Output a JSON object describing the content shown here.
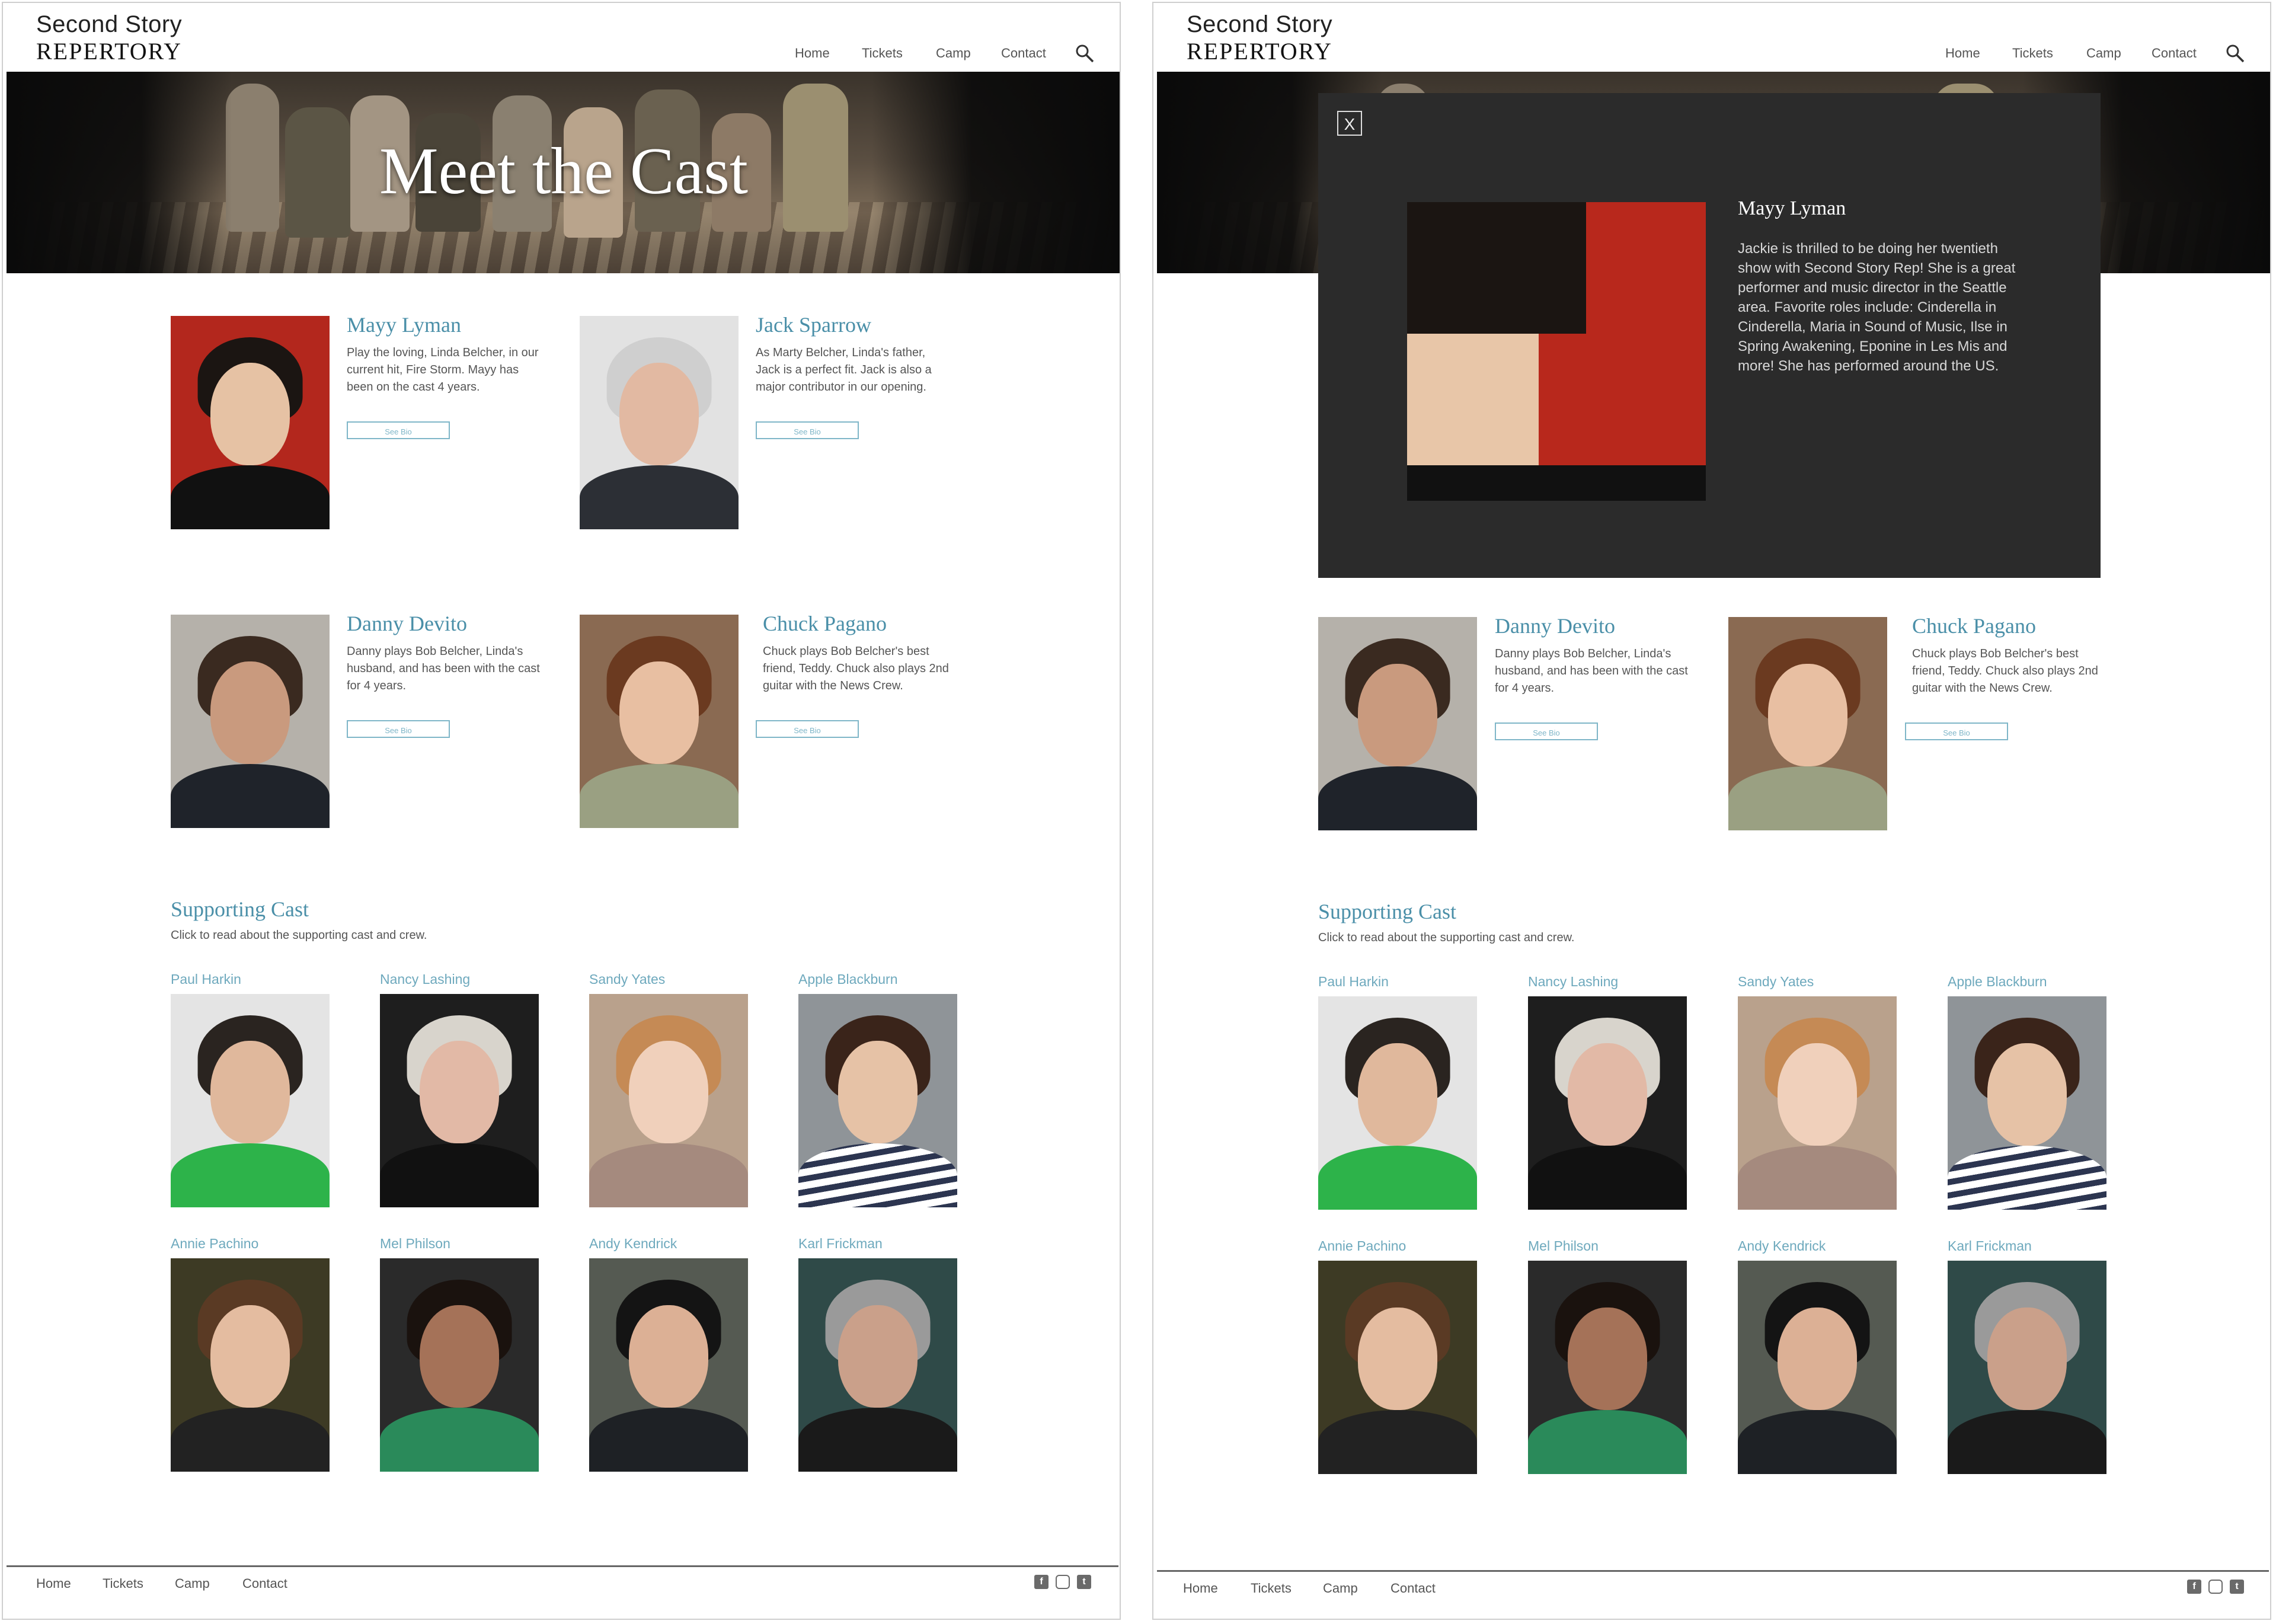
{
  "site": {
    "logo_line1": "Second Story",
    "logo_line2": "REPERTORY"
  },
  "nav": [
    "Home",
    "Tickets",
    "Camp",
    "Contact"
  ],
  "hero": {
    "title": "Meet the Cast"
  },
  "main_cast": [
    {
      "name": "Mayy Lyman",
      "desc": "Play the loving, Linda Belcher, in our current hit, Fire Storm. Mayy has been on the cast 4 years.",
      "button": "See Bio"
    },
    {
      "name": "Jack Sparrow",
      "desc": "As Marty Belcher, Linda's father, Jack is a perfect fit. Jack is also a major contributor in our opening.",
      "button": "See Bio"
    },
    {
      "name": "Danny Devito",
      "desc": "Danny plays Bob Belcher, Linda's husband, and has been with the cast for 4 years.",
      "button": "See Bio"
    },
    {
      "name": "Chuck Pagano",
      "desc": "Chuck plays Bob Belcher's best friend, Teddy. Chuck also plays 2nd guitar with the News Crew.",
      "button": "See Bio"
    }
  ],
  "supporting": {
    "title": "Supporting Cast",
    "subtitle": "Click to read about the supporting cast and crew.",
    "members": [
      "Paul Harkin",
      "Nancy Lashing",
      "Sandy Yates",
      "Apple Blackburn",
      "Annie Pachino",
      "Mel Philson",
      "Andy Kendrick",
      "Karl Frickman"
    ]
  },
  "footer": {
    "links": [
      "Home",
      "Tickets",
      "Camp",
      "Contact"
    ],
    "social_icons": [
      "facebook-icon",
      "instagram-icon",
      "twitter-icon"
    ]
  },
  "modal": {
    "close_label": "X",
    "name": "Mayy Lyman",
    "bio": "Jackie is thrilled to be doing her twentieth show with Second Story Rep! She is a great performer and music director in the Seattle area. Favorite roles include: Cinderella in Cinderella, Maria in Sound of Music, Ilse in Spring Awakening, Eponine in Les Mis and more! She has performed around the US."
  },
  "colors": {
    "accent": "#4a8fa8",
    "accent_light": "#7fb6c8",
    "modal_bg": "#2b2b2b"
  }
}
